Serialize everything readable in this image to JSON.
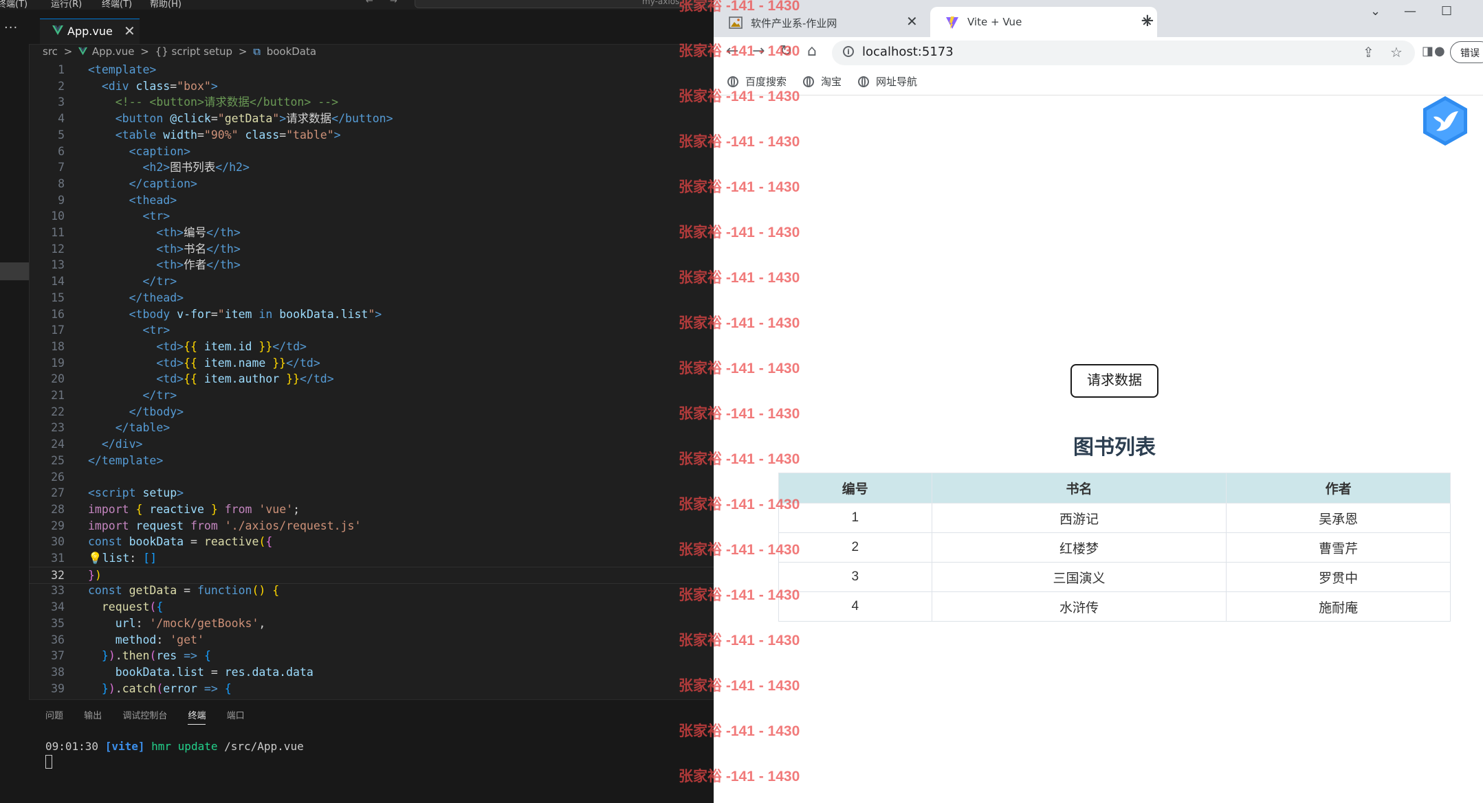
{
  "vscode": {
    "menu": [
      "终端(T)",
      "运行(R)",
      "终端(T)",
      "帮助(H)"
    ],
    "nav_back": "←",
    "nav_forward": "→",
    "command_center_text": "my-axios",
    "activity_more": "···",
    "tab": {
      "label": "App.vue",
      "close": "✕"
    },
    "breadcrumb": [
      "src",
      ">",
      "App.vue",
      ">",
      "{} script setup",
      ">",
      "bookData"
    ],
    "current_line": 32,
    "code_lines": [
      [
        [
          "t-tag",
          "<template>"
        ]
      ],
      [
        [
          "t-text",
          "  "
        ],
        [
          "t-tag",
          "<div "
        ],
        [
          "t-attr",
          "class"
        ],
        [
          "t-op",
          "="
        ],
        [
          "t-str",
          "\"box\""
        ],
        [
          "t-tag",
          ">"
        ]
      ],
      [
        [
          "t-text",
          "    "
        ],
        [
          "t-cmt",
          "<!-- <button>请求数据</button> -->"
        ]
      ],
      [
        [
          "t-text",
          "    "
        ],
        [
          "t-tag",
          "<button "
        ],
        [
          "t-attr",
          "@click"
        ],
        [
          "t-op",
          "="
        ],
        [
          "t-str",
          "\""
        ],
        [
          "t-fn",
          "getData"
        ],
        [
          "t-str",
          "\""
        ],
        [
          "t-tag",
          ">"
        ],
        [
          "t-text",
          "请求数据"
        ],
        [
          "t-tag",
          "</button>"
        ]
      ],
      [
        [
          "t-text",
          "    "
        ],
        [
          "t-tag",
          "<table "
        ],
        [
          "t-attr",
          "width"
        ],
        [
          "t-op",
          "="
        ],
        [
          "t-str",
          "\"90%\""
        ],
        [
          "t-text",
          " "
        ],
        [
          "t-attr",
          "class"
        ],
        [
          "t-op",
          "="
        ],
        [
          "t-str",
          "\"table\""
        ],
        [
          "t-tag",
          ">"
        ]
      ],
      [
        [
          "t-text",
          "      "
        ],
        [
          "t-tag",
          "<caption>"
        ]
      ],
      [
        [
          "t-text",
          "        "
        ],
        [
          "t-tag",
          "<h2>"
        ],
        [
          "t-text",
          "图书列表"
        ],
        [
          "t-tag",
          "</h2>"
        ]
      ],
      [
        [
          "t-text",
          "      "
        ],
        [
          "t-tag",
          "</caption>"
        ]
      ],
      [
        [
          "t-text",
          "      "
        ],
        [
          "t-tag",
          "<thead>"
        ]
      ],
      [
        [
          "t-text",
          "        "
        ],
        [
          "t-tag",
          "<tr>"
        ]
      ],
      [
        [
          "t-text",
          "          "
        ],
        [
          "t-tag",
          "<th>"
        ],
        [
          "t-text",
          "编号"
        ],
        [
          "t-tag",
          "</th>"
        ]
      ],
      [
        [
          "t-text",
          "          "
        ],
        [
          "t-tag",
          "<th>"
        ],
        [
          "t-text",
          "书名"
        ],
        [
          "t-tag",
          "</th>"
        ]
      ],
      [
        [
          "t-text",
          "          "
        ],
        [
          "t-tag",
          "<th>"
        ],
        [
          "t-text",
          "作者"
        ],
        [
          "t-tag",
          "</th>"
        ]
      ],
      [
        [
          "t-text",
          "        "
        ],
        [
          "t-tag",
          "</tr>"
        ]
      ],
      [
        [
          "t-text",
          "      "
        ],
        [
          "t-tag",
          "</thead>"
        ]
      ],
      [
        [
          "t-text",
          "      "
        ],
        [
          "t-tag",
          "<tbody "
        ],
        [
          "t-attr",
          "v-for"
        ],
        [
          "t-op",
          "="
        ],
        [
          "t-str",
          "\""
        ],
        [
          "t-var",
          "item"
        ],
        [
          "t-text",
          " "
        ],
        [
          "t-kw",
          "in"
        ],
        [
          "t-text",
          " "
        ],
        [
          "t-var",
          "bookData.list"
        ],
        [
          "t-str",
          "\""
        ],
        [
          "t-tag",
          ">"
        ]
      ],
      [
        [
          "t-text",
          "        "
        ],
        [
          "t-tag",
          "<tr>"
        ]
      ],
      [
        [
          "t-text",
          "          "
        ],
        [
          "t-tag",
          "<td>"
        ],
        [
          "t-brace",
          "{{ "
        ],
        [
          "t-var",
          "item.id"
        ],
        [
          "t-brace",
          " }}"
        ],
        [
          "t-tag",
          "</td>"
        ]
      ],
      [
        [
          "t-text",
          "          "
        ],
        [
          "t-tag",
          "<td>"
        ],
        [
          "t-brace",
          "{{ "
        ],
        [
          "t-var",
          "item.name"
        ],
        [
          "t-brace",
          " }}"
        ],
        [
          "t-tag",
          "</td>"
        ]
      ],
      [
        [
          "t-text",
          "          "
        ],
        [
          "t-tag",
          "<td>"
        ],
        [
          "t-brace",
          "{{ "
        ],
        [
          "t-var",
          "item.author"
        ],
        [
          "t-brace",
          " }}"
        ],
        [
          "t-tag",
          "</td>"
        ]
      ],
      [
        [
          "t-text",
          "        "
        ],
        [
          "t-tag",
          "</tr>"
        ]
      ],
      [
        [
          "t-text",
          "      "
        ],
        [
          "t-tag",
          "</tbody>"
        ]
      ],
      [
        [
          "t-text",
          "    "
        ],
        [
          "t-tag",
          "</table>"
        ]
      ],
      [
        [
          "t-text",
          "  "
        ],
        [
          "t-tag",
          "</div>"
        ]
      ],
      [
        [
          "t-tag",
          "</template>"
        ]
      ],
      [],
      [
        [
          "t-tag",
          "<script "
        ],
        [
          "t-attr",
          "setup"
        ],
        [
          "t-tag",
          ">"
        ]
      ],
      [
        [
          "t-ctrl",
          "import"
        ],
        [
          "t-text",
          " "
        ],
        [
          "t-brace",
          "{ "
        ],
        [
          "t-var",
          "reactive"
        ],
        [
          "t-brace",
          " }"
        ],
        [
          "t-text",
          " "
        ],
        [
          "t-ctrl",
          "from"
        ],
        [
          "t-text",
          " "
        ],
        [
          "t-str",
          "'vue'"
        ],
        [
          "t-text",
          ";"
        ]
      ],
      [
        [
          "t-ctrl",
          "import"
        ],
        [
          "t-text",
          " "
        ],
        [
          "t-var",
          "request"
        ],
        [
          "t-text",
          " "
        ],
        [
          "t-ctrl",
          "from"
        ],
        [
          "t-text",
          " "
        ],
        [
          "t-str",
          "'./axios/request.js'"
        ]
      ],
      [
        [
          "t-kw",
          "const"
        ],
        [
          "t-text",
          " "
        ],
        [
          "t-var",
          "bookData"
        ],
        [
          "t-op",
          " = "
        ],
        [
          "t-fn",
          "reactive"
        ],
        [
          "t-brace",
          "("
        ],
        [
          "t-brace2",
          "{"
        ]
      ],
      [
        [
          "t-text",
          "💡"
        ],
        [
          "t-var",
          "list"
        ],
        [
          "t-op",
          ": "
        ],
        [
          "t-brace3",
          "[]"
        ]
      ],
      [
        [
          "t-brace2",
          "}"
        ],
        [
          "t-brace",
          ")"
        ]
      ],
      [
        [
          "t-kw",
          "const"
        ],
        [
          "t-text",
          " "
        ],
        [
          "t-fn",
          "getData"
        ],
        [
          "t-op",
          " = "
        ],
        [
          "t-kw",
          "function"
        ],
        [
          "t-brace",
          "()"
        ],
        [
          "t-text",
          " "
        ],
        [
          "t-brace",
          "{"
        ]
      ],
      [
        [
          "t-text",
          "  "
        ],
        [
          "t-fn",
          "request"
        ],
        [
          "t-brace2",
          "("
        ],
        [
          "t-brace3",
          "{"
        ]
      ],
      [
        [
          "t-text",
          "    "
        ],
        [
          "t-var",
          "url"
        ],
        [
          "t-op",
          ": "
        ],
        [
          "t-str",
          "'/mock/getBooks'"
        ],
        [
          "t-text",
          ","
        ]
      ],
      [
        [
          "t-text",
          "    "
        ],
        [
          "t-var",
          "method"
        ],
        [
          "t-op",
          ": "
        ],
        [
          "t-str",
          "'get'"
        ]
      ],
      [
        [
          "t-text",
          "  "
        ],
        [
          "t-brace3",
          "}"
        ],
        [
          "t-brace2",
          ")"
        ],
        [
          "t-text",
          "."
        ],
        [
          "t-fn",
          "then"
        ],
        [
          "t-brace2",
          "("
        ],
        [
          "t-var",
          "res"
        ],
        [
          "t-kw",
          " => "
        ],
        [
          "t-brace3",
          "{"
        ]
      ],
      [
        [
          "t-text",
          "    "
        ],
        [
          "t-var",
          "bookData.list"
        ],
        [
          "t-op",
          " = "
        ],
        [
          "t-var",
          "res.data.data"
        ]
      ],
      [
        [
          "t-text",
          "  "
        ],
        [
          "t-brace3",
          "}"
        ],
        [
          "t-brace2",
          ")"
        ],
        [
          "t-text",
          "."
        ],
        [
          "t-fn",
          "catch"
        ],
        [
          "t-brace2",
          "("
        ],
        [
          "t-var",
          "error"
        ],
        [
          "t-kw",
          " => "
        ],
        [
          "t-brace3",
          "{"
        ]
      ]
    ],
    "panel": {
      "tabs": [
        "问题",
        "输出",
        "调试控制台",
        "终端",
        "端口"
      ],
      "active_tab": "终端",
      "terminal_time": "09:01:30",
      "terminal_tag": "[vite]",
      "terminal_msg": "hmr update",
      "terminal_path": "/src/App.vue"
    }
  },
  "browser": {
    "tabs": [
      {
        "title": "软件产业系-作业网",
        "close": "✕"
      },
      {
        "title": "Vite + Vue",
        "close": "✕"
      }
    ],
    "new_tab": "+",
    "window_controls": [
      "⌄",
      "—",
      "☐"
    ],
    "nav": {
      "back": "←",
      "forward": "→",
      "reload": "↻",
      "home": "⌂"
    },
    "info_icon": "i",
    "url": "localhost:5173",
    "omnibox_icons": [
      "⇪",
      "☆"
    ],
    "toolbar_right_icons": [
      "◨",
      "●"
    ],
    "error_button": "错误",
    "bookmarks": [
      "百度搜索",
      "淘宝",
      "网址导航"
    ],
    "page": {
      "button_label": "请求数据",
      "table_caption": "图书列表",
      "headers": [
        "编号",
        "书名",
        "作者"
      ],
      "rows": [
        [
          "1",
          "西游记",
          "吴承恩"
        ],
        [
          "2",
          "红楼梦",
          "曹雪芹"
        ],
        [
          "3",
          "三国演义",
          "罗贯中"
        ],
        [
          "4",
          "水浒传",
          "施耐庵"
        ]
      ]
    }
  },
  "watermark": {
    "text": "张家裕 -141 - 1430",
    "repeat": 18,
    "color": "#eb4646"
  },
  "colors": {
    "editor_bg": "#1f1f1f",
    "accent": "#0078d4",
    "table_header_bg": "#cde6ea",
    "vue_green": "#41b883"
  }
}
